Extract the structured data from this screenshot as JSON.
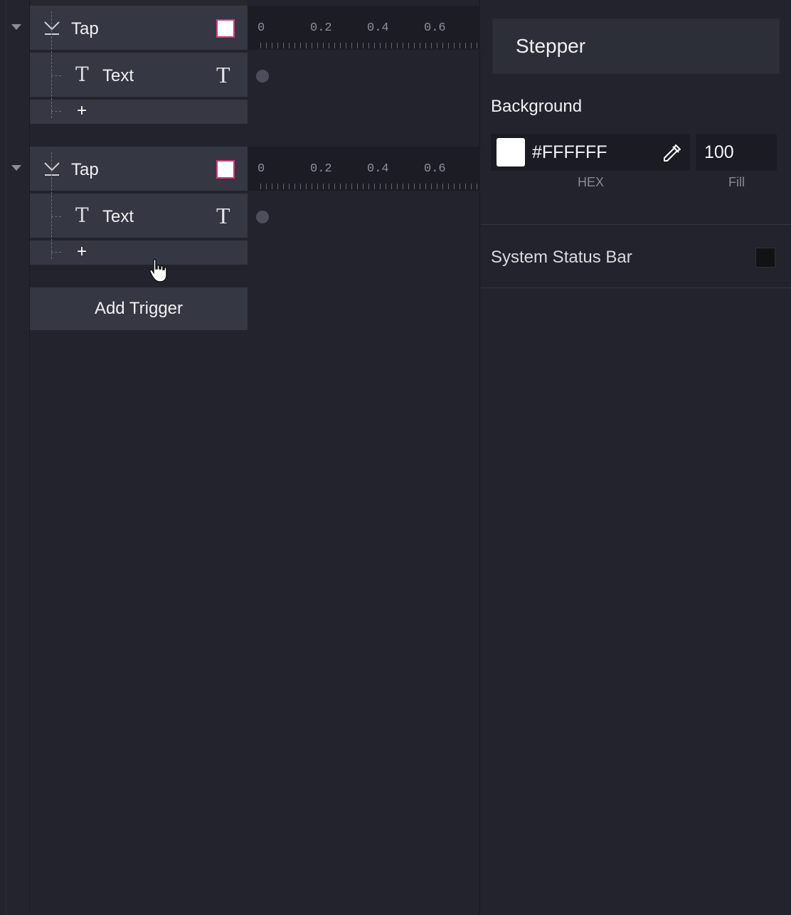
{
  "triggers": [
    {
      "label": "Tap",
      "child_label": "Text",
      "child_icon_glyph": "T",
      "child_right_glyph": "T",
      "add_glyph": "+",
      "ruler_ticks": [
        "0",
        "0.2",
        "0.4",
        "0.6"
      ]
    },
    {
      "label": "Tap",
      "child_label": "Text",
      "child_icon_glyph": "T",
      "child_right_glyph": "T",
      "add_glyph": "+",
      "ruler_ticks": [
        "0",
        "0.2",
        "0.4",
        "0.6"
      ]
    }
  ],
  "add_trigger_label": "Add Trigger",
  "inspector": {
    "name": "Stepper",
    "background_label": "Background",
    "hex_value": "#FFFFFF",
    "fill_value": "100",
    "hex_caption": "HEX",
    "fill_caption": "Fill",
    "status_bar_label": "System Status Bar"
  },
  "colors": {
    "accent_pink": "#d23a78",
    "background_swatch": "#ffffff",
    "panel": "#353742",
    "app_bg": "#22232c"
  },
  "icons": {
    "collapse": "caret-down-icon",
    "trigger": "tap-gesture-icon",
    "dropper": "eyedropper-icon",
    "cursor": "hand-pointer-cursor"
  }
}
